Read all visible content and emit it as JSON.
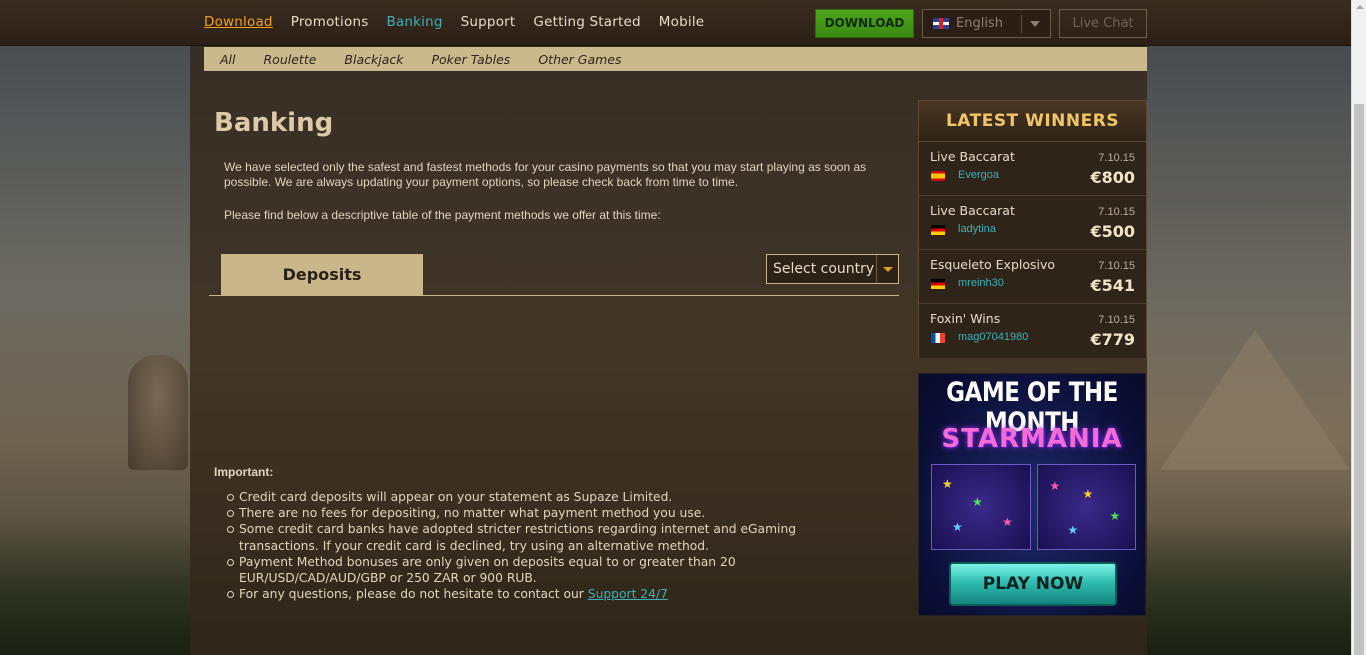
{
  "nav": {
    "items": [
      {
        "label": "Download",
        "state": "highlight"
      },
      {
        "label": "Promotions",
        "state": ""
      },
      {
        "label": "Banking",
        "state": "active"
      },
      {
        "label": "Support",
        "state": ""
      },
      {
        "label": "Getting Started",
        "state": ""
      },
      {
        "label": "Mobile",
        "state": ""
      }
    ],
    "download_button": "DOWNLOAD",
    "language": "English",
    "live_chat": "Live Chat"
  },
  "subnav": [
    "All",
    "Roulette",
    "Blackjack",
    "Poker Tables",
    "Other Games"
  ],
  "main": {
    "title": "Banking",
    "intro": "We have selected only the safest and fastest methods for your casino payments so that you may start playing as soon as possible. We are always updating your payment options, so please check back from time to time.",
    "intro2": "Please find below a descriptive table of the payment methods we offer at this time:",
    "tab_deposits": "Deposits",
    "country_select_placeholder": "Select country",
    "important_title": "Important:",
    "important_items": [
      "Credit card deposits will appear on your statement as Supaze Limited.",
      "There are no fees for depositing, no matter what payment method you use.",
      "Some credit card banks have adopted stricter restrictions regarding internet and eGaming transactions. If your credit card is declined, try using an alternative method.",
      "Payment Method bonuses are only given on deposits equal to or greater than 20 EUR/USD/CAD/AUD/GBP or 250 ZAR or 900 RUB."
    ],
    "last_item_text": "For any questions, please do not hesitate to contact our ",
    "support_link": "Support 24/7"
  },
  "winners": {
    "title": "LATEST WINNERS",
    "rows": [
      {
        "game": "Live Baccarat",
        "date": "7.10.15",
        "user": "Evergoa",
        "amount": "€800",
        "flag": "es"
      },
      {
        "game": "Live Baccarat",
        "date": "7.10.15",
        "user": "ladytina",
        "amount": "€500",
        "flag": "de"
      },
      {
        "game": "Esqueleto Explosivo",
        "date": "7.10.15",
        "user": "mreinh30",
        "amount": "€541",
        "flag": "de"
      },
      {
        "game": "Foxin' Wins",
        "date": "7.10.15",
        "user": "mag07041980",
        "amount": "€779",
        "flag": "fr"
      }
    ]
  },
  "game_of_month": {
    "title": "GAME OF THE MONTH",
    "game_name": "STARMANIA",
    "play_button": "PLAY NOW"
  },
  "colors": {
    "accent_orange": "#f2a21c",
    "accent_teal": "#3fb0b4",
    "download_green": "#4fa51d",
    "tab_tan": "#c9b68a",
    "winners_gold": "#f0c766"
  }
}
